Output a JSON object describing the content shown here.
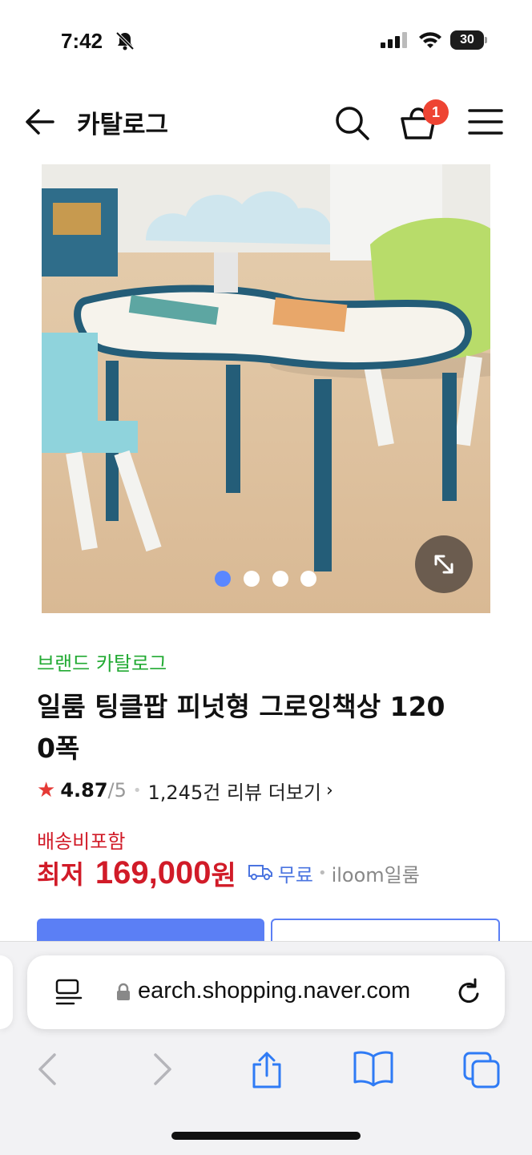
{
  "status_bar": {
    "time": "7:42",
    "battery": "30"
  },
  "app_bar": {
    "title": "카탈로그",
    "cart_count": "1"
  },
  "gallery": {
    "total_images": 4,
    "active_index": 0
  },
  "product": {
    "brand_label": "브랜드 카탈로그",
    "title_line1": "일룸 팅클팝 피넛형 그로잉책상 120",
    "title_line2": "0폭",
    "rating": "4.87",
    "rating_max": "/5",
    "reviews_link": "1,245건 리뷰 더보기",
    "shipping_note": "배송비포함",
    "price_label": "최저",
    "price": "169,000",
    "price_unit": "원",
    "free_shipping": "무료",
    "seller": "iloom일룸"
  },
  "browser": {
    "url": "search.shopping.naver.com",
    "url_visible": "earch.shopping.naver.com"
  },
  "colors": {
    "accent": "#5b7ff5",
    "price_red": "#d11b28",
    "brand_green": "#22aa33",
    "badge_red": "#ee4433"
  }
}
